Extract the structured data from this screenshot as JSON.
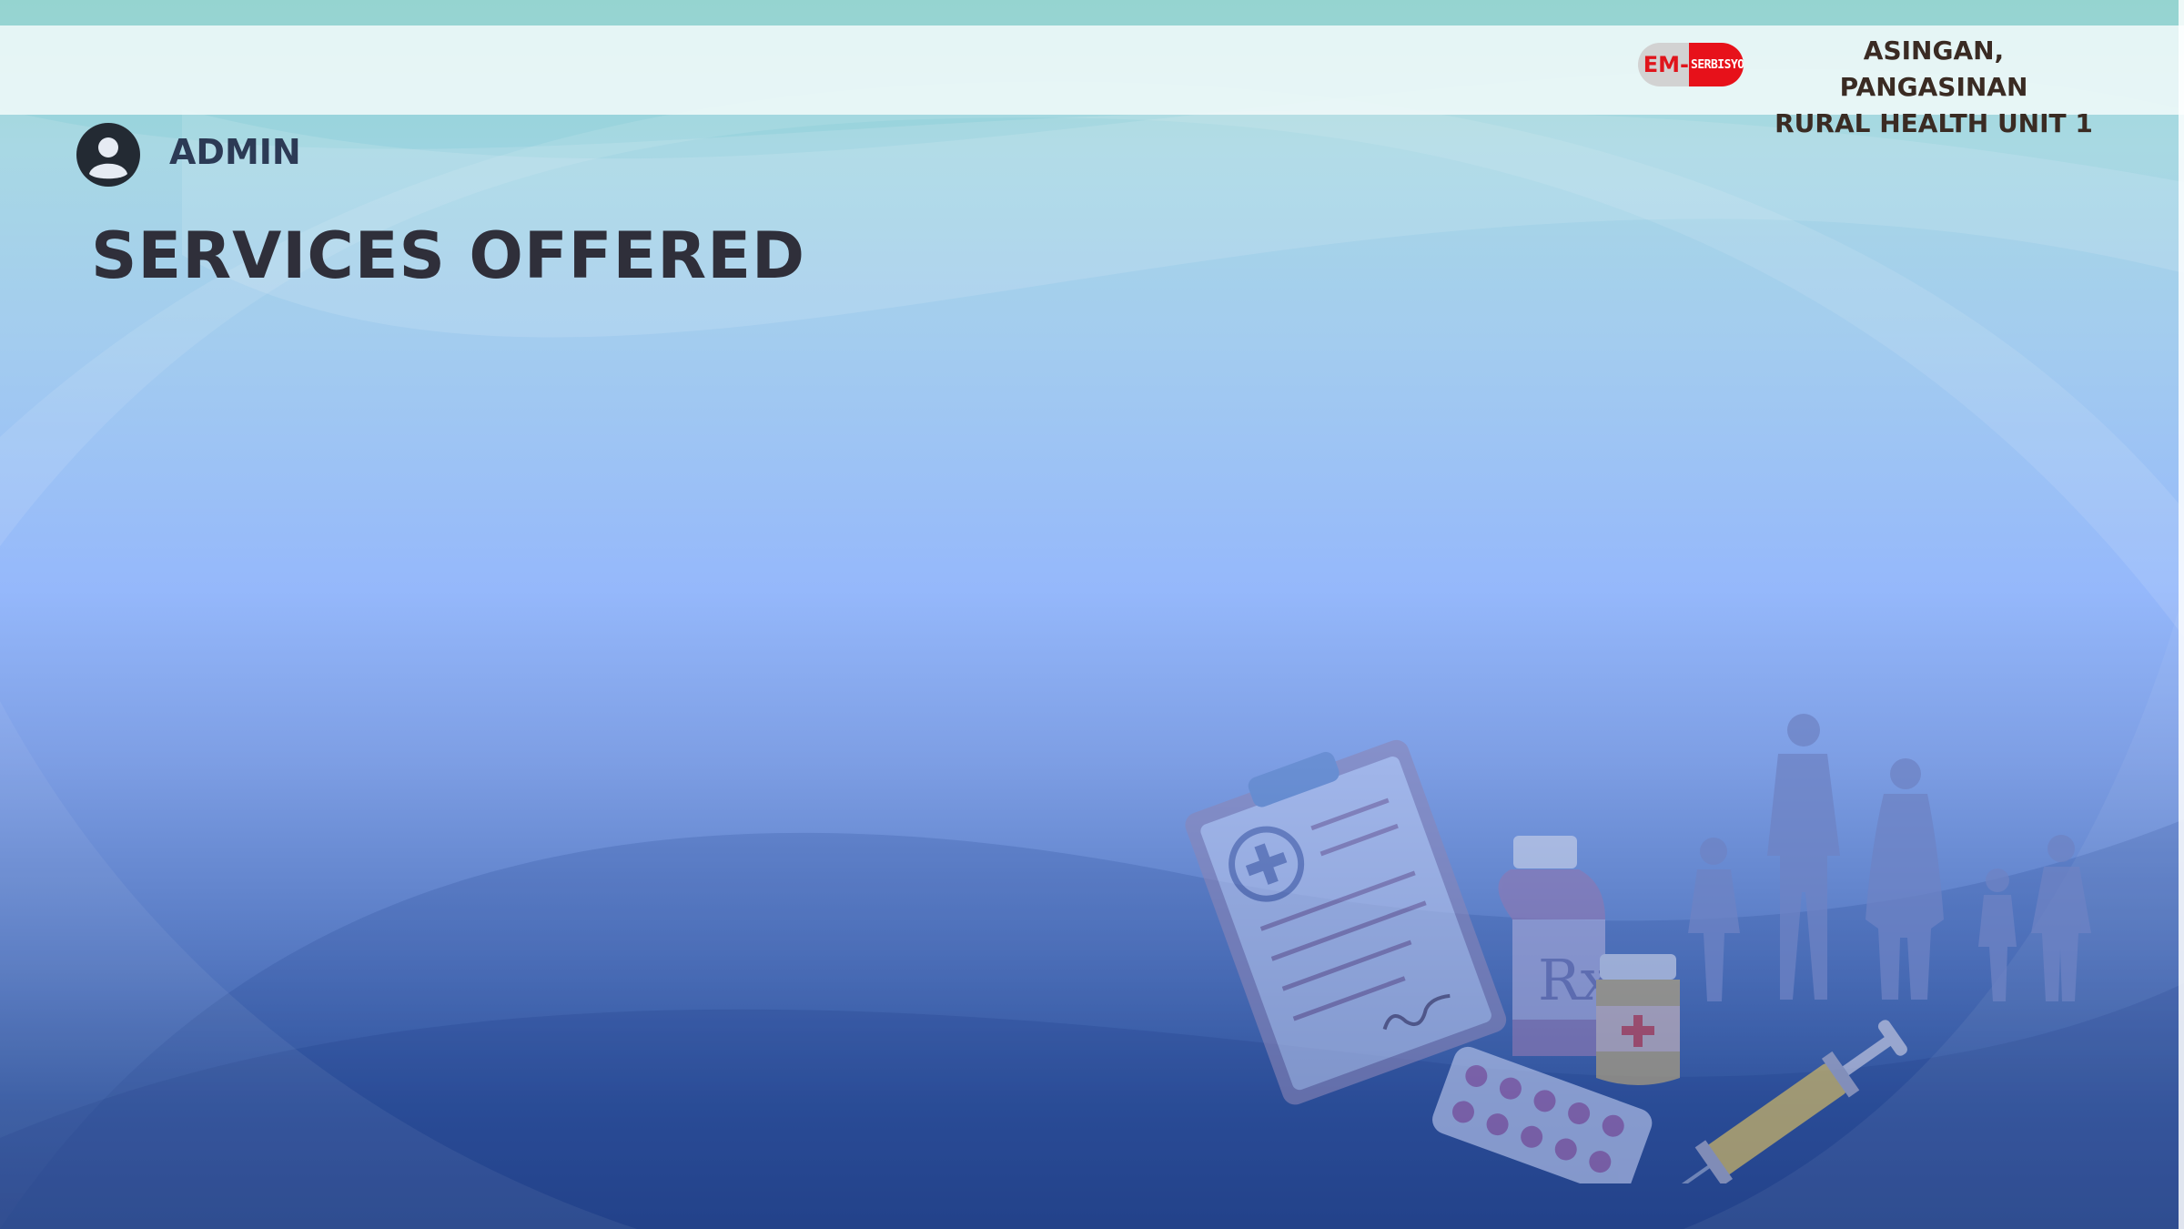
{
  "header": {
    "logo": {
      "left_text": "EM-",
      "right_text": "SERBISYO"
    },
    "location_line1": "ASINGAN, PANGASINAN",
    "location_line2": "RURAL HEALTH UNIT 1"
  },
  "user": {
    "role_label": "ADMIN",
    "icon": "user-avatar-icon"
  },
  "page": {
    "title": "SERVICES OFFERED"
  },
  "illustration": {
    "items": [
      "clipboard-icon",
      "medicine-bottle-icon",
      "pill-blister-icon",
      "syringe-icon",
      "family-silhouette-icon"
    ],
    "rx_label": "Rx"
  },
  "colors": {
    "accent_red": "#e7111a",
    "title_text": "#2f2f3a",
    "header_text": "#3a2b23"
  }
}
